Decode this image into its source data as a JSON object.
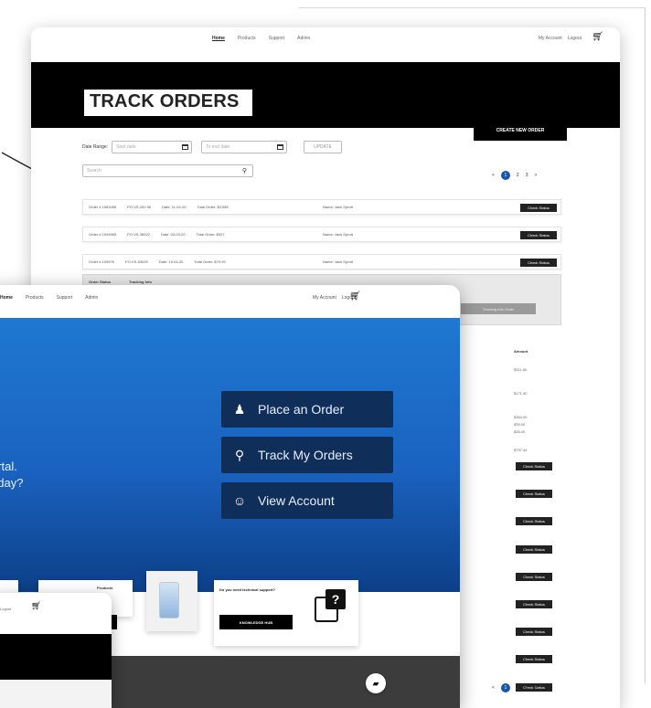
{
  "track_orders": {
    "nav": {
      "items": [
        "Home",
        "Products",
        "Support",
        "Admin"
      ],
      "account": "My Account",
      "logout": "Logout"
    },
    "title": "TRACK ORDERS",
    "create_button": "CREATE NEW ORDER",
    "date_range_label": "Date Range:",
    "start_placeholder": "Start date",
    "end_placeholder": "To end date",
    "update_button": "UPDATE",
    "search_placeholder": "Search",
    "pager": {
      "prev": "<",
      "current": "1",
      "page2": "2",
      "page3": "3",
      "next": ">"
    },
    "orders": [
      {
        "order": "Order # 1083496",
        "po": "PO:VS-200 96",
        "date": "Date: 11-02-20",
        "total": "Total Order: $3,085",
        "name": "Name: Jack Sprott"
      },
      {
        "order": "Order # 1094965",
        "po": "PO:VS-38922",
        "date": "Date: 03-03-20",
        "total": "Total Order: $527",
        "name": "Name: Jack Sprott"
      },
      {
        "order": "Order # 109576",
        "po": "PO:VS-53025",
        "date": "Date: 19-04-20",
        "total": "Total Order: $79.99",
        "name": "Name: Jack Sprott"
      }
    ],
    "check_status": "Check Status",
    "detail": {
      "order_status": "Order Status",
      "tracking_info": "Tracking Info",
      "tracking_button": "Tracking Info Order",
      "table_col2": "Amount",
      "amounts": [
        "$311.60",
        "$171.90"
      ],
      "summary": [
        "$364.00",
        "$35.00",
        "$28.40",
        "$797.44"
      ]
    },
    "extra_status_rows": 9
  },
  "portal": {
    "nav": {
      "items": [
        "Home",
        "Products",
        "Support",
        "Admin"
      ],
      "account": "My Account",
      "logout": "Logout"
    },
    "hero_line1": "ortal.",
    "hero_line2": "oday?",
    "actions": [
      {
        "icon": "person-pin-icon",
        "glyph": "♟",
        "label": "Place an Order"
      },
      {
        "icon": "map-pin-icon",
        "glyph": "⚲",
        "label": "Track My Orders"
      },
      {
        "icon": "user-icon",
        "glyph": "☺",
        "label": "View Account"
      }
    ],
    "product_card_title": "Products",
    "support_card": {
      "question": "Do you need technical support?",
      "button": "KNOWLEDGE HUB"
    }
  },
  "front": {
    "logout": "Logout"
  },
  "colors": {
    "blue_top": "#1f78d0",
    "blue_bottom": "#0c3f88",
    "button_navy": "#0f2f5a",
    "pager_blue": "#1a56a8"
  }
}
